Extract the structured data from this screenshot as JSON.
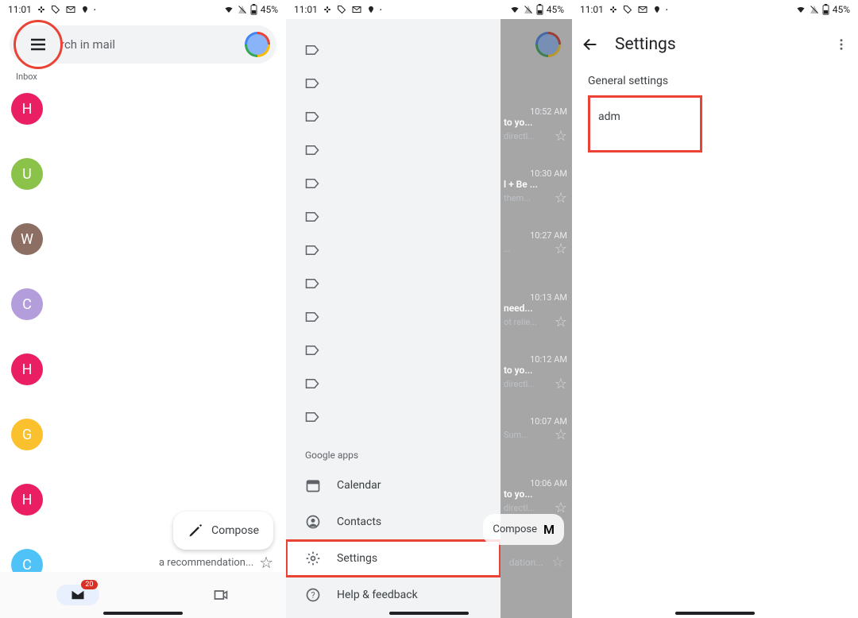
{
  "status": {
    "time": "11:01",
    "battery": "45%",
    "icons_left": [
      "slack-icon",
      "tag-icon",
      "gmail-icon",
      "location-icon",
      "dot-icon"
    ],
    "icons_right": [
      "wifi-icon",
      "signal-off-icon",
      "battery-icon"
    ]
  },
  "screen1": {
    "search_placeholder": "Search in mail",
    "search_visible": "rch in mail",
    "inbox_label": "Inbox",
    "senders": [
      {
        "letter": "H",
        "color": "#e91e63"
      },
      {
        "letter": "U",
        "color": "#8bc34a"
      },
      {
        "letter": "W",
        "color": "#8d6e63"
      },
      {
        "letter": "C",
        "color": "#b39ddb"
      },
      {
        "letter": "H",
        "color": "#e91e63"
      },
      {
        "letter": "G",
        "color": "#fbc02d"
      },
      {
        "letter": "H",
        "color": "#e91e63"
      },
      {
        "letter": "C",
        "color": "#4fc3f7"
      }
    ],
    "compose": "Compose",
    "recommendation_text": "a recommendation...",
    "badge_count": "20"
  },
  "screen2": {
    "google_apps_header": "Google apps",
    "apps": [
      {
        "key": "calendar",
        "label": "Calendar"
      },
      {
        "key": "contacts",
        "label": "Contacts"
      },
      {
        "key": "settings",
        "label": "Settings"
      },
      {
        "key": "help",
        "label": "Help & feedback"
      }
    ],
    "peek_compose": "Compose",
    "peek_letter": "M",
    "peek_recommend": "dation...",
    "emails": [
      {
        "time": "10:52 AM",
        "l1": "to yo...",
        "l2": "directl..."
      },
      {
        "time": "10:30 AM",
        "l1": "l + Be ...",
        "l2": "them..."
      },
      {
        "time": "10:27 AM",
        "l1": "",
        "l2": "..."
      },
      {
        "time": "10:13 AM",
        "l1": "need...",
        "l2": "ot relie..."
      },
      {
        "time": "10:12 AM",
        "l1": "to yo...",
        "l2": "directl..."
      },
      {
        "time": "10:07 AM",
        "l1": "",
        "l2": "Sum..."
      },
      {
        "time": "10:06 AM",
        "l1": "to yo...",
        "l2": "directl..."
      }
    ]
  },
  "screen3": {
    "title": "Settings",
    "general": "General settings",
    "account_partial": "adm"
  }
}
